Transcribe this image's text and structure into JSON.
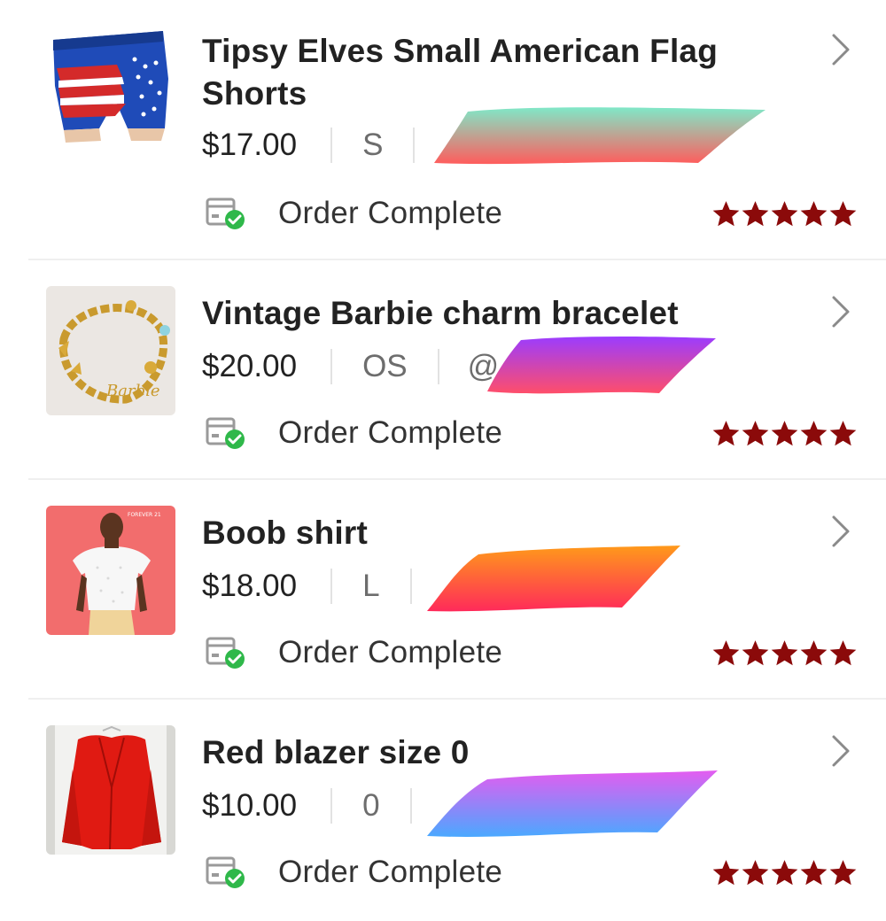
{
  "icons": {
    "chevron": "chevron-right-icon",
    "status": "package-check-icon",
    "star": "star-icon"
  },
  "colors": {
    "star": "#8b0a0a",
    "check": "#2fb84a",
    "chevron": "#8a8a8a"
  },
  "orders": [
    {
      "title_line1": "Tipsy Elves Small American Flag",
      "title_line2": "Shorts",
      "price": "$17.00",
      "size": "S",
      "status": "Order Complete",
      "rating": 5,
      "image": "american-flag-shorts"
    },
    {
      "title_line1": "Vintage Barbie charm bracelet",
      "title_line2": "",
      "price": "$20.00",
      "size": "OS",
      "seller_prefix": "@",
      "status": "Order Complete",
      "rating": 5,
      "image": "gold-charm-bracelet"
    },
    {
      "title_line1": "Boob shirt",
      "title_line2": "",
      "price": "$18.00",
      "size": "L",
      "status": "Order Complete",
      "rating": 5,
      "image": "white-crop-top"
    },
    {
      "title_line1": "Red blazer size 0",
      "title_line2": "",
      "price": "$10.00",
      "size": "0",
      "status": "Order Complete",
      "rating": 5,
      "image": "red-blazer"
    }
  ]
}
